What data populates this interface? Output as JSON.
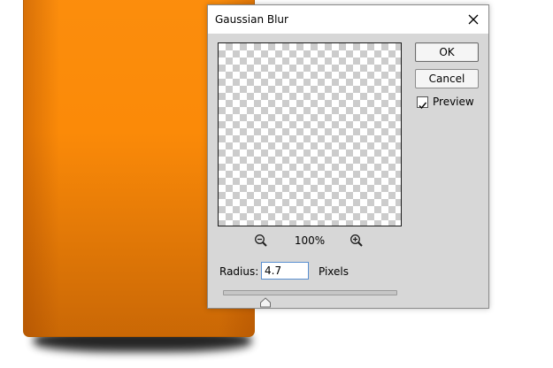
{
  "dialog": {
    "title": "Gaussian Blur",
    "close_icon": "close-icon",
    "zoom_out_icon": "zoom-out-icon",
    "zoom_in_icon": "zoom-in-icon",
    "zoom_level": "100%",
    "radius_label": "Radius:",
    "radius_value": "4.7",
    "units_label": "Pixels",
    "slider_value": 4.7,
    "ok_label": "OK",
    "cancel_label": "Cancel",
    "preview_label": "Preview",
    "preview_checked": true
  },
  "colors": {
    "canvas_orange": "#fb8a08",
    "dialog_body": "#d7d7d7",
    "input_focus_border": "#5a8fd0"
  }
}
